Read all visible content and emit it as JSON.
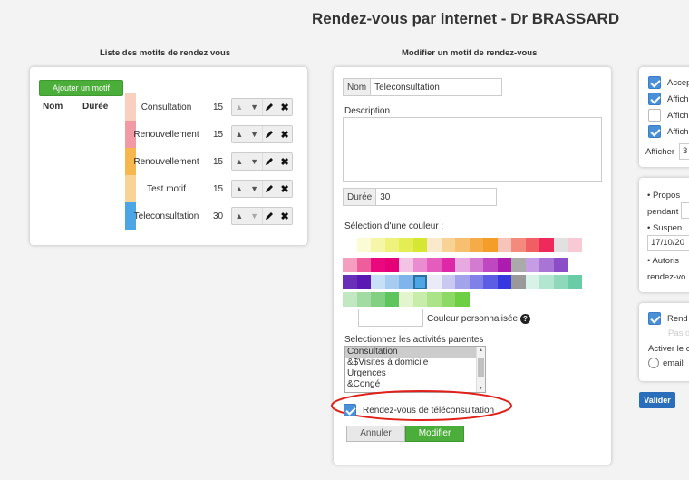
{
  "header": {
    "title": "Rendez-vous par internet - Dr BRASSARD"
  },
  "left": {
    "title": "Liste des motifs de rendez vous",
    "add_button": "Ajouter un motif",
    "col_name": "Nom",
    "col_duration": "Durée",
    "rows": [
      {
        "name": "Consultation",
        "duration": "15",
        "color": "#f9d0bf"
      },
      {
        "name": "Renouvellement",
        "duration": "15",
        "color": "#f19aa5"
      },
      {
        "name": "Renouvellement",
        "duration": "15",
        "color": "#f7b74f"
      },
      {
        "name": "Test motif",
        "duration": "15",
        "color": "#f9d296"
      },
      {
        "name": "Teleconsultation",
        "duration": "30",
        "color": "#4ca6e6"
      }
    ],
    "controls": {
      "up": "▲",
      "down": "▼",
      "edit": "pencil-icon",
      "delete": "✖"
    }
  },
  "form": {
    "title": "Modifier un motif de rendez-vous",
    "name_label": "Nom",
    "name_value": "Teleconsultation",
    "description_label": "Description",
    "description_value": "",
    "duration_label": "Durée",
    "duration_value": "30",
    "color_label": "Sélection d'une couleur :",
    "custom_color_label": "Couleur personnalisée",
    "custom_color_value": "",
    "help_icon": "?",
    "palette": [
      [
        "#ffffff",
        "#fbfbd6",
        "#f5f6a8",
        "#eef27c",
        "#e4ee54",
        "#d6e733",
        "#fbe9cc",
        "#f9d296",
        "#f7c070",
        "#f5ac48",
        "#f49e2a",
        "#f7c4bc",
        "#f48a7d",
        "#f15e63",
        "#ee2a5c",
        "#e1e1e1",
        "#f8cad6"
      ],
      [
        "#f59ec0",
        "#ef5e9c",
        "#e9087e",
        "#e60077",
        "#f3c3e5",
        "#ea8dd0",
        "#e55cbd",
        "#df28a7",
        "#e8a9e1",
        "#d37bd0",
        "#bf47bf",
        "#ae1bb0",
        "#aaaaaa",
        "#c69ce4",
        "#a874d6",
        "#8b4dc8"
      ],
      [
        "#6a2fb8",
        "#5c18b2",
        "#c7e0f5",
        "#a6cdf0",
        "#7fb5ea",
        "#4ca6e6",
        "#ebebf8",
        "#c8c8f0",
        "#a3a3ec",
        "#8080e8",
        "#5c5ce4",
        "#3838e0",
        "#999999",
        "#d9f2e8",
        "#b3e6d0",
        "#8ed9bb",
        "#6acca6"
      ],
      [
        "#c1e8c1",
        "#a3dca3",
        "#82d082",
        "#5ec55e",
        "#e3f5cc",
        "#c8ecaa",
        "#abe388",
        "#8dd966",
        "#6dcf44"
      ]
    ],
    "parents_label": "Selectionnez les activités parentes",
    "parents_options": [
      "Consultation",
      "&$Visites à domicile",
      "Urgences",
      "&Congé"
    ],
    "teleconsult_label": "Rendez-vous de téléconsultation",
    "cancel_label": "Annuler",
    "save_label": "Modifier"
  },
  "right": {
    "checks": [
      {
        "label": "Accep",
        "checked": true
      },
      {
        "label": "Affich",
        "checked": true
      },
      {
        "label": "Affich",
        "checked": false
      },
      {
        "label": "Affich",
        "checked": true
      }
    ],
    "show_label": "Afficher",
    "show_value": "3",
    "propose_label": "• Propos",
    "pendant_label": "pendant",
    "suspend_label": "• Suspen",
    "date_value": "17/10/20",
    "autorise_label": "• Autoris",
    "rdv_label": "rendez-vo",
    "rend_label": "Rend",
    "pas_label": "Pas d",
    "activer_label": "Activer le c",
    "email_label": "email",
    "validate_label": "Valider"
  }
}
